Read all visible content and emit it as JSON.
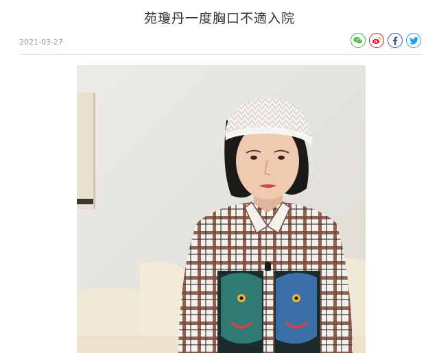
{
  "article": {
    "title": "苑瓊丹一度胸口不適入院",
    "date": "2021-03-27"
  },
  "share": {
    "buttons": [
      {
        "name": "wechat",
        "icon": "wechat-icon",
        "color": "#3db23d"
      },
      {
        "name": "weibo",
        "icon": "weibo-icon",
        "color": "#e6162d"
      },
      {
        "name": "facebook",
        "icon": "facebook-icon",
        "color": "#3b5998"
      },
      {
        "name": "twitter",
        "icon": "twitter-icon",
        "color": "#1da1f2"
      }
    ]
  },
  "photo": {
    "subject": "woman-in-white-knit-cap-and-plaid-shirt"
  }
}
